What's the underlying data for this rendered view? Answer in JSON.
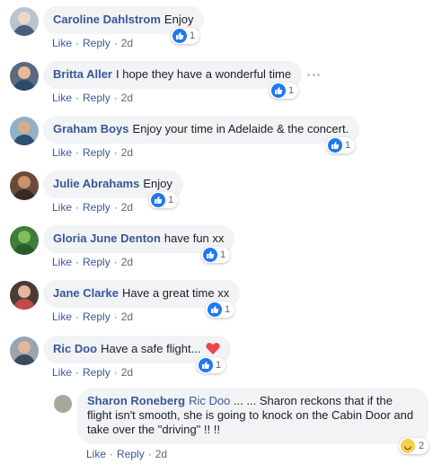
{
  "comments": [
    {
      "author": "Caroline Dahlstrom",
      "text": "Enjoy",
      "like": "Like",
      "reply": "Reply",
      "time": "2d",
      "reaction_count": "1"
    },
    {
      "author": "Britta Aller",
      "text": "I hope they have a wonderful time",
      "like": "Like",
      "reply": "Reply",
      "time": "2d",
      "reaction_count": "1"
    },
    {
      "author": "Graham Boys",
      "text": "Enjoy your time in Adelaide & the concert.",
      "like": "Like",
      "reply": "Reply",
      "time": "2d",
      "reaction_count": "1"
    },
    {
      "author": "Julie Abrahams",
      "text": "Enjoy",
      "like": "Like",
      "reply": "Reply",
      "time": "2d",
      "reaction_count": "1"
    },
    {
      "author": "Gloria June Denton",
      "text": "have fun xx",
      "like": "Like",
      "reply": "Reply",
      "time": "2d",
      "reaction_count": "1"
    },
    {
      "author": "Jane Clarke",
      "text": "Have a great time xx",
      "like": "Like",
      "reply": "Reply",
      "time": "2d",
      "reaction_count": "1"
    },
    {
      "author": "Ric Doo",
      "text": "Have a safe flight...",
      "like": "Like",
      "reply": "Reply",
      "time": "2d",
      "reaction_count": "1"
    }
  ],
  "reply": {
    "author": "Sharon Roneberg",
    "mention": "Ric Doo",
    "text": " ... ... Sharon reckons that if the flight isn't smooth, she is going to knock on the Cabin Door and take over the \"driving\" !! !!",
    "like": "Like",
    "reply": "Reply",
    "time": "2d",
    "reaction_count": "2"
  },
  "icons": {
    "like": "thumbs-up-icon",
    "heart": "heart-icon",
    "haha": "haha-icon",
    "more": "more-options-icon"
  },
  "colors": {
    "link": "#385898",
    "bubble": "#f2f3f5",
    "like_blue": "#2078f4",
    "heart_red": "#e8474f",
    "meta": "#606770"
  }
}
